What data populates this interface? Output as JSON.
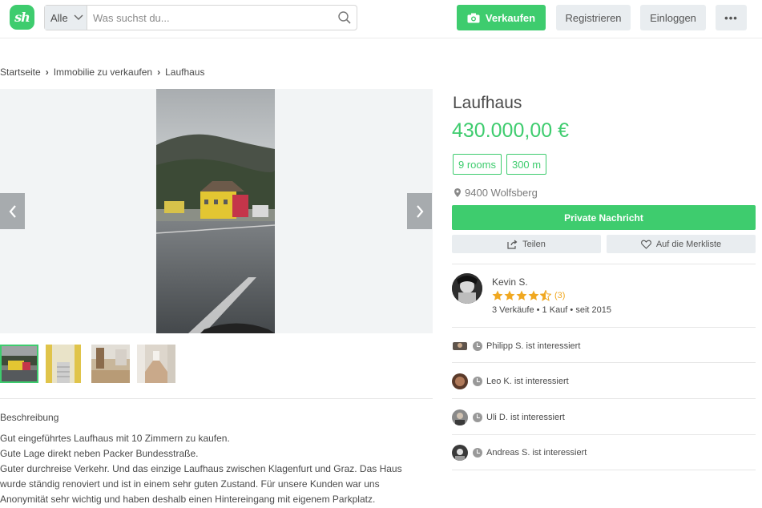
{
  "header": {
    "logo_text": "sh",
    "search": {
      "category": "Alle",
      "placeholder": "Was suchst du..."
    },
    "sell_label": "Verkaufen",
    "register_label": "Registrieren",
    "login_label": "Einloggen",
    "more_label": "•••"
  },
  "breadcrumb": {
    "items": [
      "Startseite",
      "Immobilie zu verkaufen",
      "Laufhaus"
    ]
  },
  "listing": {
    "title": "Laufhaus",
    "price": "430.000,00 €",
    "tags": [
      "9 rooms",
      "300 m"
    ],
    "location": "9400 Wolfsberg",
    "message_label": "Private Nachricht",
    "share_label": "Teilen",
    "favorite_label": "Auf die Merkliste"
  },
  "seller": {
    "name": "Kevin S.",
    "rating": 4.5,
    "rating_count": "(3)",
    "stats": "3 Verkäufe • 1 Kauf • seit 2015"
  },
  "interested": [
    {
      "text": "Philipp S. ist interessiert"
    },
    {
      "text": "Leo K. ist interessiert"
    },
    {
      "text": "Uli D. ist interessiert"
    },
    {
      "text": "Andreas S. ist interessiert"
    }
  ],
  "description": {
    "heading": "Beschreibung",
    "lines": [
      "Gut eingeführtes Laufhaus mit 10 Zimmern zu kaufen.",
      "Gute Lage direkt neben Packer Bundesstraße.",
      "Guter durchreise Verkehr. Und das einzige Laufhaus zwischen Klagenfurt und Graz. Das Haus",
      "wurde ständig renoviert und ist in einem sehr guten Zustand. Für unsere Kunden war uns",
      "Anonymität sehr wichtig und haben deshalb einen Hintereingang mit eigenem Parkplatz."
    ]
  },
  "colors": {
    "brand_green": "#3ecc6e",
    "button_gray": "#e9edf0",
    "star": "#f0a821"
  }
}
